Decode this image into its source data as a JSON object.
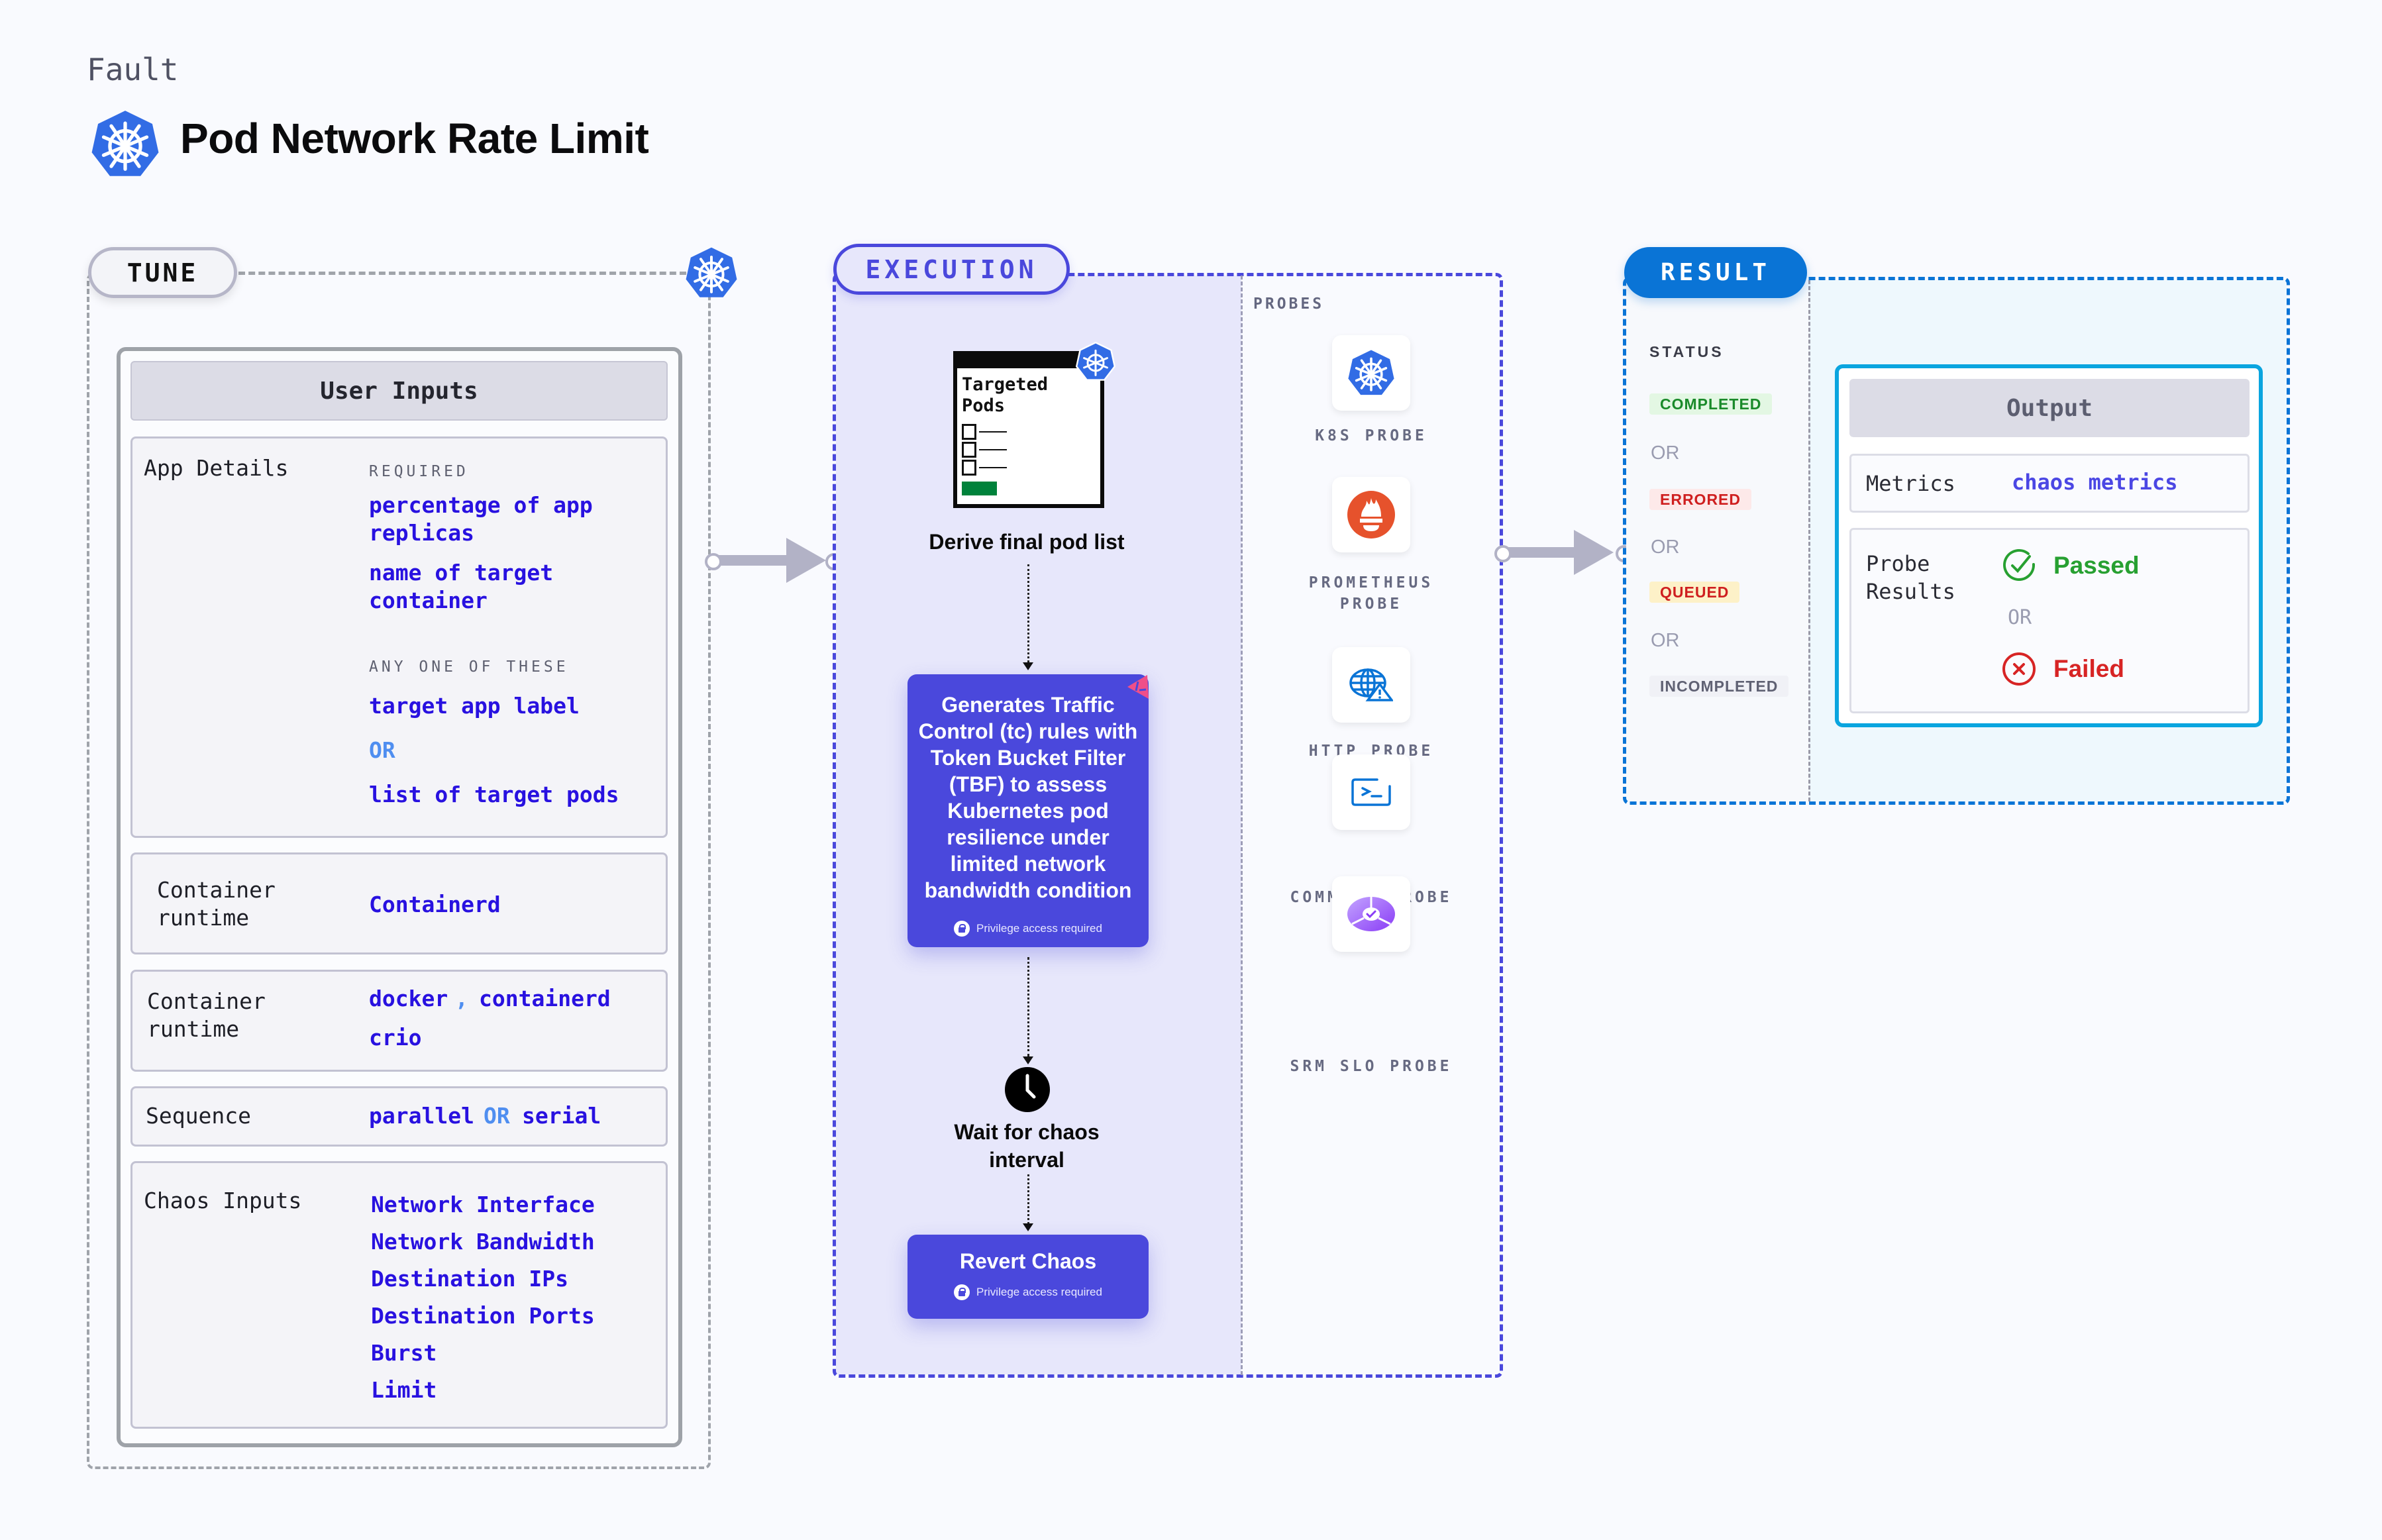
{
  "header": {
    "category": "Fault",
    "title": "Pod Network Rate Limit",
    "title_icon": "kubernetes-icon"
  },
  "tune": {
    "label": "TUNE",
    "icon": "kubernetes-icon",
    "panel_title": "User Inputs",
    "app_details": {
      "label": "App Details",
      "required_hint": "REQUIRED",
      "required": [
        "percentage of app replicas",
        "name of target container"
      ],
      "any_one_hint": "ANY ONE OF THESE",
      "options": [
        "target app label",
        "OR",
        "list of target pods"
      ]
    },
    "container_runtime_1": {
      "label": "Container runtime",
      "value": "Containerd"
    },
    "container_runtime_2": {
      "label": "Container runtime",
      "values": [
        "docker",
        ",",
        "containerd",
        "crio"
      ]
    },
    "sequence": {
      "label": "Sequence",
      "values": [
        "parallel",
        "OR",
        "serial"
      ]
    },
    "chaos_inputs": {
      "label": "Chaos Inputs",
      "values": [
        "Network Interface",
        "Network Bandwidth",
        "Destination IPs",
        "Destination Ports",
        "Burst",
        "Limit"
      ]
    }
  },
  "execution": {
    "label": "EXECUTION",
    "pods_card": {
      "title": "Targeted Pods",
      "rows": 3
    },
    "steps": [
      {
        "label": "Derive final pod list"
      },
      {
        "label": "Generates Traffic Control (tc) rules with Token Bucket Filter (TBF) to assess Kubernetes pod resilience under limited network bandwidth condition",
        "note": "Privilege access required"
      },
      {
        "label": "Wait for chaos interval"
      },
      {
        "label": "Revert Chaos",
        "note": "Privilege access required"
      }
    ]
  },
  "probes": {
    "label": "PROBES",
    "items": [
      {
        "label": "K8S PROBE",
        "icon": "kubernetes-icon"
      },
      {
        "label": "PROMETHEUS PROBE",
        "icon": "prometheus-icon"
      },
      {
        "label": "HTTP PROBE",
        "icon": "globe-warning-icon"
      },
      {
        "label": "COMMAND PROBE",
        "icon": "terminal-icon"
      },
      {
        "label": "SRM SLO PROBE",
        "icon": "slo-icon"
      }
    ]
  },
  "result": {
    "label": "RESULT",
    "status_label": "STATUS",
    "statuses": [
      {
        "label": "COMPLETED",
        "color": "#1a8a2a",
        "bg": "#e3f7e3"
      },
      {
        "label": "ERRORED",
        "color": "#cf1f1f",
        "bg": "#fde9e9"
      },
      {
        "label": "QUEUED",
        "color": "#cf1f1f",
        "bg": "#fdf1c8"
      },
      {
        "label": "INCOMPLETED",
        "color": "#5f6173",
        "bg": "#f0f1f6"
      }
    ],
    "or_text": "OR",
    "output": {
      "title": "Output",
      "metrics_label": "Metrics",
      "metrics_value": "chaos metrics",
      "probe_results_label": "Probe Results",
      "passed": "Passed",
      "or_text": "OR",
      "failed": "Failed",
      "passed_color": "#27a031",
      "failed_color": "#d72424"
    }
  }
}
